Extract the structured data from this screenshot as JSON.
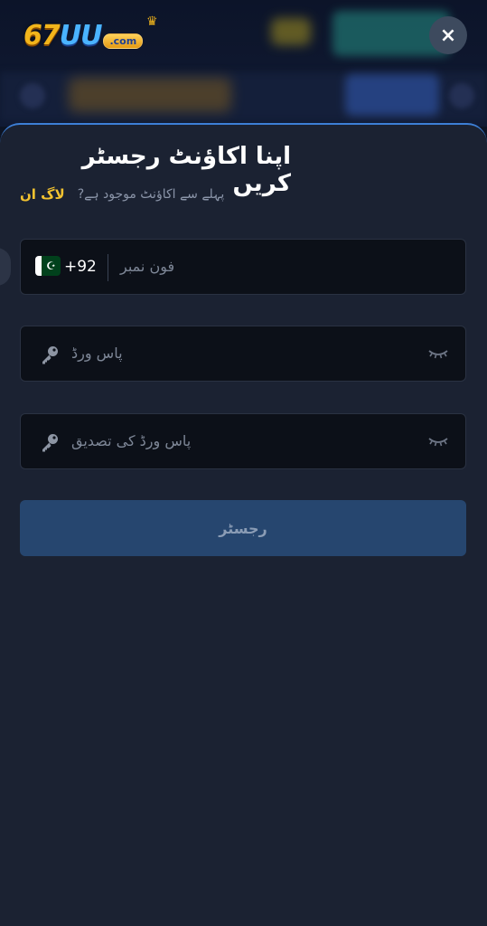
{
  "app": {
    "logo_main": "67",
    "logo_uu": "UU",
    "logo_domain": ".com"
  },
  "dialog": {
    "close_icon": "×",
    "title": "اپنا اکاؤنٹ رجسٹر کریں",
    "have_account": "?پہلے سے اکاؤنٹ موجود ہے",
    "login_link": "لاگ ان",
    "phone": {
      "country_code": "+92",
      "placeholder": "فون نمبر",
      "flag_icon": "pakistan-flag-icon"
    },
    "password": {
      "placeholder": "پاس ورڈ",
      "lead_icon": "key-icon",
      "trail_icon": "eye-closed-icon"
    },
    "confirm_password": {
      "placeholder": "پاس ورڈ کی تصدیق",
      "lead_icon": "key-icon",
      "trail_icon": "eye-closed-icon"
    },
    "register_button": "رجسٹر"
  },
  "colors": {
    "accent_link": "#f2c230",
    "button_bg": "#26466f",
    "sheet_bg": "#1b2232",
    "sheet_border": "#3d7fd6"
  }
}
